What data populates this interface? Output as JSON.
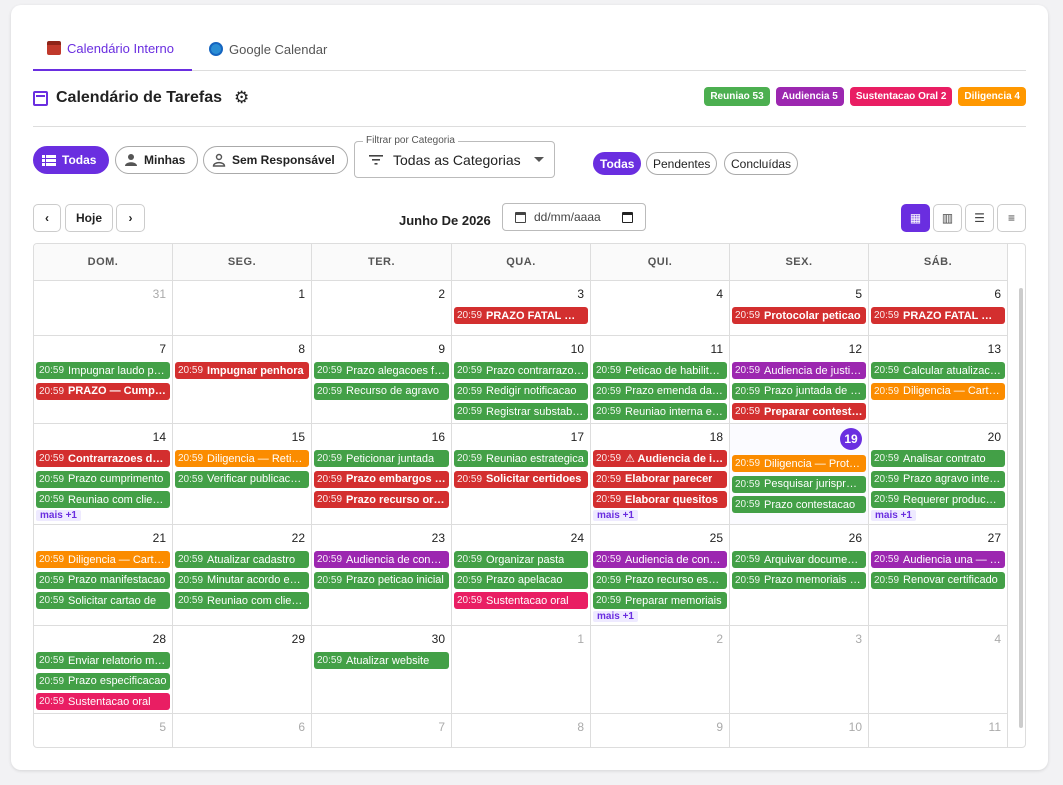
{
  "tabs": [
    {
      "label": "Calendário Interno",
      "icon": "calendar-icon"
    },
    {
      "label": "Google Calendar",
      "icon": "globe-icon"
    }
  ],
  "header": {
    "title": "Calendário de Tarefas",
    "badges": [
      {
        "label": "Reuniao 53",
        "color": "#4caf50"
      },
      {
        "label": "Audiencia 5",
        "color": "#9c27b0"
      },
      {
        "label": "Sustentacao Oral 2",
        "color": "#e91e63"
      },
      {
        "label": "Diligencia 4",
        "color": "#ff9800"
      }
    ]
  },
  "filters": {
    "responsavel": [
      "Todas",
      "Minhas",
      "Sem Responsável"
    ],
    "category_label": "Filtrar por Categoria",
    "category_value": "Todas as Categorias",
    "status": [
      "Todas",
      "Pendentes",
      "Concluídas"
    ]
  },
  "nav": {
    "today_label": "Hoje",
    "month_label": "Junho De 2026",
    "date_placeholder": "dd/mm/aaaa"
  },
  "calendar": {
    "weekdays": [
      "DOM.",
      "SEG.",
      "TER.",
      "QUA.",
      "QUI.",
      "SEX.",
      "SÁB."
    ],
    "more_label": "mais +1",
    "colors": {
      "g": "#43a047",
      "r": "#d32f2f",
      "p": "#9c27b0",
      "o": "#fb8c00",
      "k": "#e91e63"
    },
    "weeks": [
      [
        {
          "d": "31",
          "other": true,
          "events": []
        },
        {
          "d": "1",
          "events": []
        },
        {
          "d": "2",
          "events": []
        },
        {
          "d": "3",
          "events": [
            {
              "t": "20:59",
              "x": "PRAZO FATAL — Recurso",
              "c": "r",
              "b": true
            }
          ]
        },
        {
          "d": "4",
          "events": []
        },
        {
          "d": "5",
          "events": [
            {
              "t": "20:59",
              "x": "Protocolar peticao",
              "c": "r",
              "b": true
            }
          ]
        },
        {
          "d": "6",
          "events": [
            {
              "t": "20:59",
              "x": "PRAZO FATAL — Apelacao",
              "c": "r",
              "b": true
            }
          ]
        }
      ],
      [
        {
          "d": "7",
          "events": [
            {
              "t": "20:59",
              "x": "Impugnar laudo pericial",
              "c": "g"
            },
            {
              "t": "20:59",
              "x": "PRAZO — Cumprimento",
              "c": "r",
              "b": true
            }
          ]
        },
        {
          "d": "8",
          "events": [
            {
              "t": "20:59",
              "x": "Impugnar penhora",
              "c": "r",
              "b": true
            }
          ]
        },
        {
          "d": "9",
          "events": [
            {
              "t": "20:59",
              "x": "Prazo alegacoes finais",
              "c": "g"
            },
            {
              "t": "20:59",
              "x": "Recurso de agravo",
              "c": "g"
            }
          ]
        },
        {
          "d": "10",
          "events": [
            {
              "t": "20:59",
              "x": "Prazo contrarrazoes",
              "c": "g"
            },
            {
              "t": "20:59",
              "x": "Redigir notificacao",
              "c": "g"
            },
            {
              "t": "20:59",
              "x": "Registrar substabelecimento",
              "c": "g"
            }
          ]
        },
        {
          "d": "11",
          "events": [
            {
              "t": "20:59",
              "x": "Peticao de habilitacao",
              "c": "g"
            },
            {
              "t": "20:59",
              "x": "Prazo emenda da inicial",
              "c": "g"
            },
            {
              "t": "20:59",
              "x": "Reuniao interna equipe",
              "c": "g"
            }
          ]
        },
        {
          "d": "12",
          "events": [
            {
              "t": "20:59",
              "x": "Audiencia de justificacao",
              "c": "p"
            },
            {
              "t": "20:59",
              "x": "Prazo juntada de documentos",
              "c": "g"
            },
            {
              "t": "20:59",
              "x": "Preparar contestacao",
              "c": "r",
              "b": true
            }
          ]
        },
        {
          "d": "13",
          "events": [
            {
              "t": "20:59",
              "x": "Calcular atualizacao",
              "c": "g"
            },
            {
              "t": "20:59",
              "x": "Diligencia — Cartorio",
              "c": "o"
            }
          ]
        }
      ],
      [
        {
          "d": "14",
          "events": [
            {
              "t": "20:59",
              "x": "Contrarrazoes de apelacao",
              "c": "r",
              "b": true
            },
            {
              "t": "20:59",
              "x": "Prazo cumprimento",
              "c": "g"
            },
            {
              "t": "20:59",
              "x": "Reuniao com cliente",
              "c": "g"
            }
          ],
          "more": true
        },
        {
          "d": "15",
          "events": [
            {
              "t": "20:59",
              "x": "Diligencia — Retirada",
              "c": "o"
            },
            {
              "t": "20:59",
              "x": "Verificar publicacoes",
              "c": "g"
            }
          ]
        },
        {
          "d": "16",
          "events": [
            {
              "t": "20:59",
              "x": "Peticionar juntada",
              "c": "g"
            },
            {
              "t": "20:59",
              "x": "Prazo embargos de declaracao",
              "c": "r",
              "b": true
            },
            {
              "t": "20:59",
              "x": "Prazo recurso ordinario",
              "c": "r",
              "b": true
            }
          ]
        },
        {
          "d": "17",
          "events": [
            {
              "t": "20:59",
              "x": "Reuniao estrategica",
              "c": "g"
            },
            {
              "t": "20:59",
              "x": "Solicitar certidoes",
              "c": "r",
              "b": true
            }
          ]
        },
        {
          "d": "18",
          "events": [
            {
              "t": "20:59",
              "x": "⚠ Audiencia de instrucao",
              "c": "r",
              "b": true
            },
            {
              "t": "20:59",
              "x": "Elaborar parecer",
              "c": "r",
              "b": true
            },
            {
              "t": "20:59",
              "x": "Elaborar quesitos",
              "c": "r",
              "b": true
            }
          ],
          "more": true
        },
        {
          "d": "19",
          "today": true,
          "events": [
            {
              "t": "20:59",
              "x": "Diligencia — Protocolo",
              "c": "o"
            },
            {
              "t": "20:59",
              "x": "Pesquisar jurisprudencia",
              "c": "g"
            },
            {
              "t": "20:59",
              "x": "Prazo contestacao",
              "c": "g"
            }
          ]
        },
        {
          "d": "20",
          "events": [
            {
              "t": "20:59",
              "x": "Analisar contrato",
              "c": "g"
            },
            {
              "t": "20:59",
              "x": "Prazo agravo interno",
              "c": "g"
            },
            {
              "t": "20:59",
              "x": "Requerer producao de provas",
              "c": "g"
            }
          ],
          "more": true
        }
      ],
      [
        {
          "d": "21",
          "events": [
            {
              "t": "20:59",
              "x": "Diligencia — Cartorio",
              "c": "o"
            },
            {
              "t": "20:59",
              "x": "Prazo manifestacao",
              "c": "g"
            },
            {
              "t": "20:59",
              "x": "Solicitar cartao de",
              "c": "g"
            }
          ]
        },
        {
          "d": "22",
          "events": [
            {
              "t": "20:59",
              "x": "Atualizar cadastro",
              "c": "g"
            },
            {
              "t": "20:59",
              "x": "Minutar acordo extrajudicial",
              "c": "g"
            },
            {
              "t": "20:59",
              "x": "Reuniao com cliente",
              "c": "g"
            }
          ]
        },
        {
          "d": "23",
          "events": [
            {
              "t": "20:59",
              "x": "Audiencia de conciliacao",
              "c": "p"
            },
            {
              "t": "20:59",
              "x": "Prazo peticao inicial",
              "c": "g"
            }
          ]
        },
        {
          "d": "24",
          "events": [
            {
              "t": "20:59",
              "x": "Organizar pasta",
              "c": "g"
            },
            {
              "t": "20:59",
              "x": "Prazo apelacao",
              "c": "g"
            },
            {
              "t": "20:59",
              "x": "Sustentacao oral",
              "c": "k"
            }
          ]
        },
        {
          "d": "25",
          "events": [
            {
              "t": "20:59",
              "x": "Audiencia de conciliacao",
              "c": "p"
            },
            {
              "t": "20:59",
              "x": "Prazo recurso especial",
              "c": "g"
            },
            {
              "t": "20:59",
              "x": "Preparar memoriais",
              "c": "g"
            }
          ],
          "more": true
        },
        {
          "d": "26",
          "events": [
            {
              "t": "20:59",
              "x": "Arquivar documentos",
              "c": "g"
            },
            {
              "t": "20:59",
              "x": "Prazo memoriais finais",
              "c": "g"
            }
          ]
        },
        {
          "d": "27",
          "events": [
            {
              "t": "20:59",
              "x": "Audiencia una — Trabalhista",
              "c": "p"
            },
            {
              "t": "20:59",
              "x": "Renovar certificado",
              "c": "g"
            }
          ]
        }
      ],
      [
        {
          "d": "28",
          "events": [
            {
              "t": "20:59",
              "x": "Enviar relatorio mensal",
              "c": "g"
            },
            {
              "t": "20:59",
              "x": "Prazo especificacao",
              "c": "g"
            },
            {
              "t": "20:59",
              "x": "Sustentacao oral",
              "c": "k"
            }
          ]
        },
        {
          "d": "29",
          "events": []
        },
        {
          "d": "30",
          "events": [
            {
              "t": "20:59",
              "x": "Atualizar website",
              "c": "g"
            }
          ]
        },
        {
          "d": "1",
          "other": true,
          "events": []
        },
        {
          "d": "2",
          "other": true,
          "events": []
        },
        {
          "d": "3",
          "other": true,
          "events": []
        },
        {
          "d": "4",
          "other": true,
          "events": []
        }
      ],
      [
        {
          "d": "5",
          "other": true,
          "events": []
        },
        {
          "d": "6",
          "other": true,
          "events": []
        },
        {
          "d": "7",
          "other": true,
          "events": []
        },
        {
          "d": "8",
          "other": true,
          "events": []
        },
        {
          "d": "9",
          "other": true,
          "events": []
        },
        {
          "d": "10",
          "other": true,
          "events": []
        },
        {
          "d": "11",
          "other": true,
          "events": []
        }
      ]
    ]
  }
}
